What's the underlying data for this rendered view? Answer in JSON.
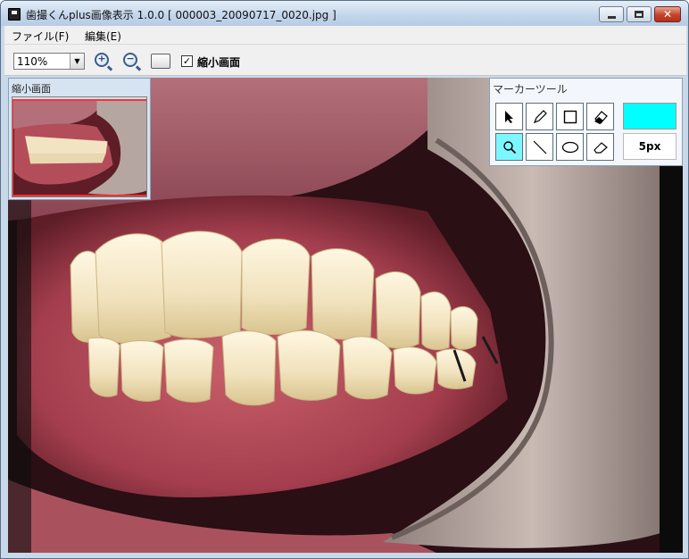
{
  "window": {
    "title": "歯撮くんplus画像表示 1.0.0 [ 000003_20090717_0020.jpg ]"
  },
  "menu": {
    "file": "ファイル(F)",
    "edit": "編集(E)"
  },
  "toolbar": {
    "zoom_value": "110%",
    "thumbnail_checkbox_label": "縮小画面",
    "thumbnail_checked": true
  },
  "thumbnail_panel": {
    "title": "縮小画面"
  },
  "marker_panel": {
    "title": "マーカーツール",
    "tools": [
      {
        "icon": "pointer-icon",
        "active": false
      },
      {
        "icon": "pencil-icon",
        "active": false
      },
      {
        "icon": "rectangle-icon",
        "active": false
      },
      {
        "icon": "clear-all-icon",
        "active": false
      },
      {
        "icon": "magnifier-icon",
        "active": true
      },
      {
        "icon": "line-icon",
        "active": false
      },
      {
        "icon": "ellipse-icon",
        "active": false
      },
      {
        "icon": "eraser-icon",
        "active": false
      }
    ],
    "color": "#00ffff",
    "size": "5px"
  }
}
